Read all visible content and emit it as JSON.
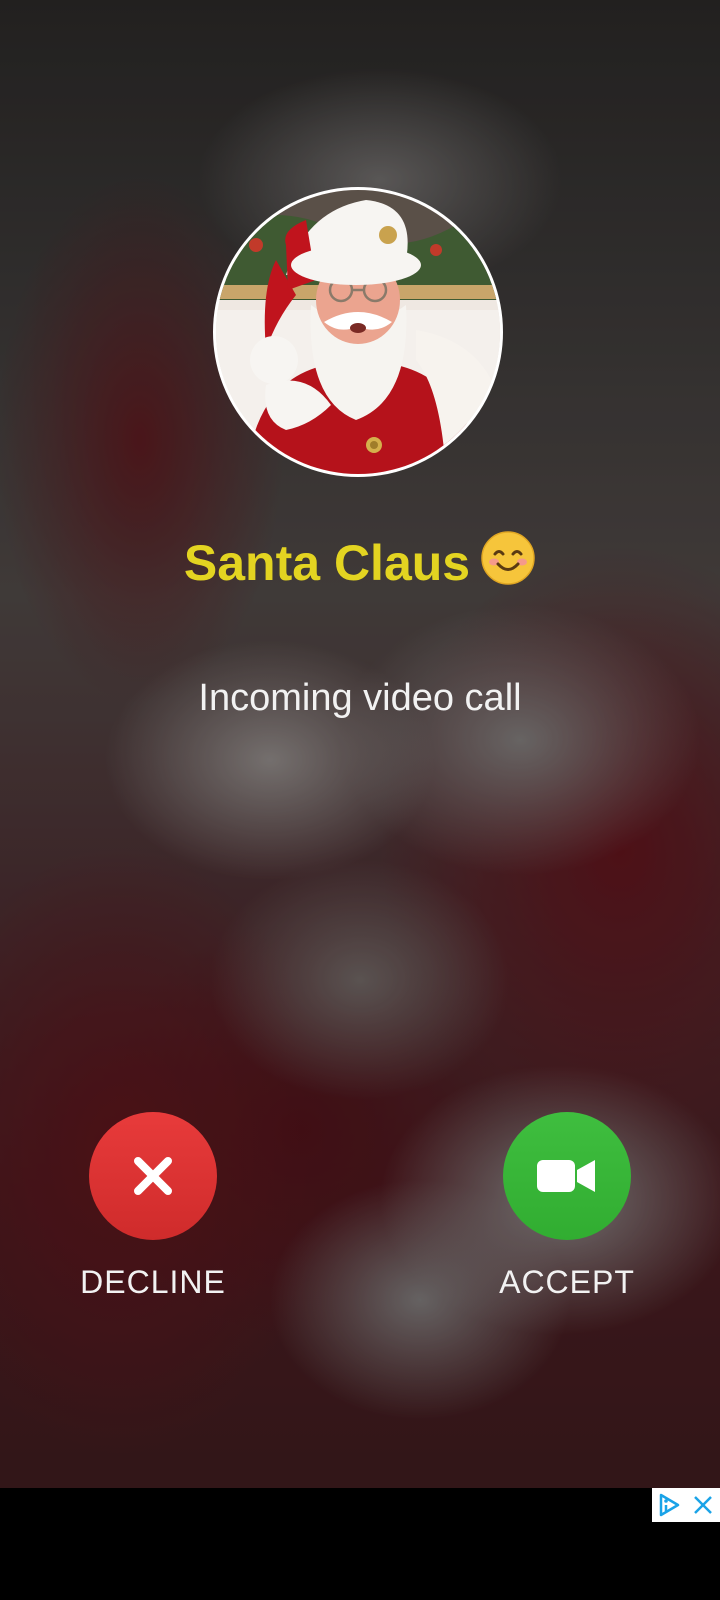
{
  "caller": {
    "name": "Santa Claus",
    "emoji_icon": "smiling-face-icon",
    "status": "Incoming video call",
    "name_color": "#e3d421"
  },
  "actions": {
    "decline": {
      "label": "DECLINE",
      "icon": "close-icon",
      "color": "#de3535"
    },
    "accept": {
      "label": "ACCEPT",
      "icon": "video-camera-icon",
      "color": "#38b838"
    }
  },
  "ad": {
    "choices_icon": "adchoices-icon",
    "close_icon": "close-icon",
    "accent_color": "#1aa3e8"
  }
}
